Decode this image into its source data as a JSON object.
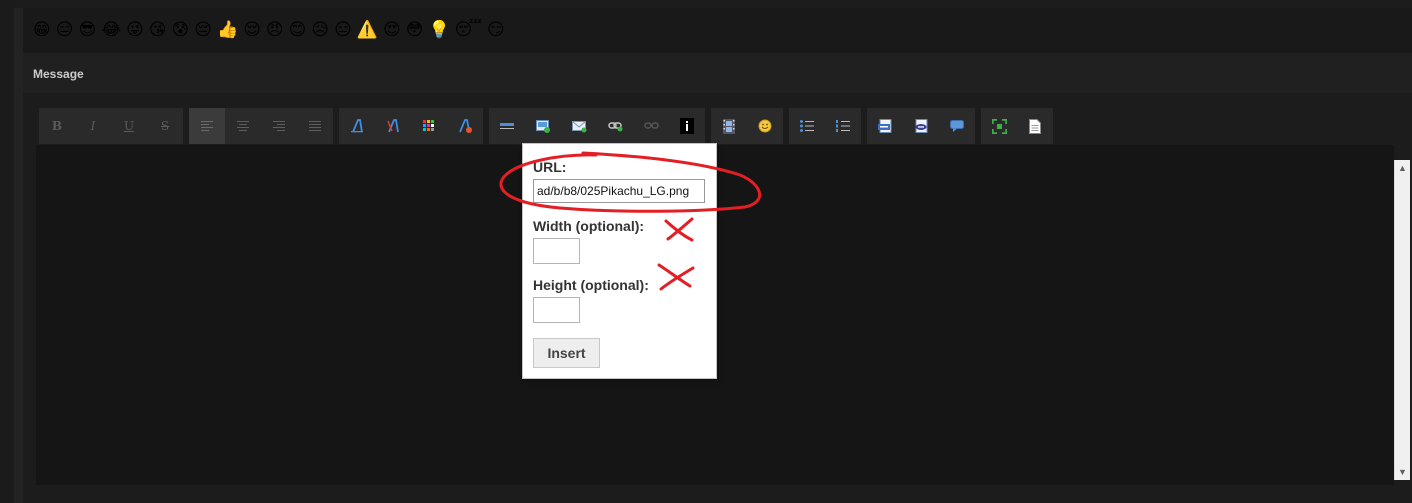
{
  "emojis": [
    "😁",
    "😑",
    "😎",
    "😂",
    "😜",
    "😘",
    "😰",
    "😔",
    "👍",
    "😌",
    "😠",
    "😊",
    "😥",
    "😑",
    "⚠️",
    "😍",
    "😳",
    "💡",
    "😴",
    "😏"
  ],
  "section": {
    "title": "Message"
  },
  "toolbar": {
    "bold_label": "B",
    "italic_label": "I",
    "underline_label": "U",
    "strike_label": "S"
  },
  "image_dialog": {
    "url_label": "URL:",
    "url_value": "ad/b/b8/025Pikachu_LG.png",
    "width_label": "Width (optional):",
    "height_label": "Height (optional):",
    "insert_label": "Insert"
  },
  "scrollbar": {
    "up_arrow": "▲",
    "down_arrow": "▼"
  },
  "colors": {
    "annotation_red": "#e31e24",
    "background": "#232323",
    "editor": "#151515"
  }
}
